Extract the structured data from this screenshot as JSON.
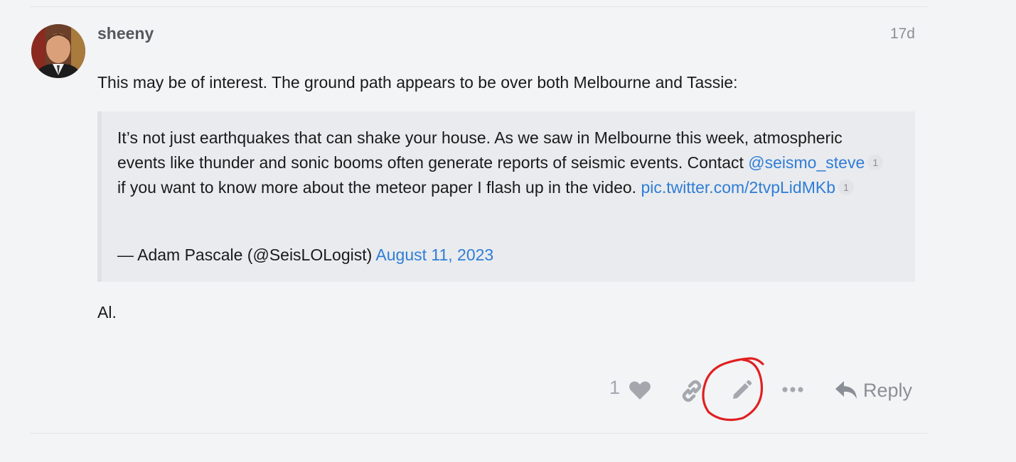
{
  "post": {
    "username": "sheeny",
    "date": "17d",
    "intro": "This may be of interest. The ground path appears to be over both Melbourne and Tassie:",
    "quote": {
      "line1": "It’s not just earthquakes that can shake your house. As we saw in Melbourne this week, atmospheric events like thunder and sonic booms often generate reports of seismic events. Contact ",
      "mention": "@seismo_steve",
      "mention_count": "1",
      "line2": " if you want to know more about the meteor paper I flash up in the video. ",
      "pic_link": "pic.twitter.com/2tvpLidMKb",
      "pic_count": "1",
      "attribution": "— Adam Pascale (@SeisLOLogist) ",
      "attribution_date": "August 11, 2023"
    },
    "signoff": "Al."
  },
  "actions": {
    "like_count": "1",
    "reply_label": "Reply",
    "icons": [
      "heart-icon",
      "link-icon",
      "pencil-icon",
      "more-icon",
      "reply-icon"
    ]
  },
  "colors": {
    "background": "#f3f4f6",
    "link": "#2f7dd6",
    "muted": "#8a8f96",
    "annotation": "#e02020"
  }
}
